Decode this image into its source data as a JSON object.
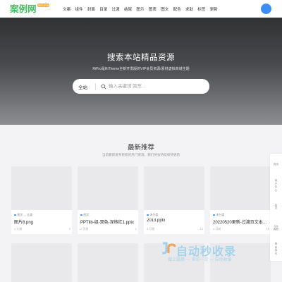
{
  "header": {
    "logo_text": "案例网",
    "logo_badge": "anli.ooo",
    "nav": [
      "文案",
      "组件",
      "封面",
      "目录",
      "过渡",
      "结尾",
      "图示",
      "图表",
      "图文",
      "配色",
      "求助",
      "标签",
      "更新"
    ]
  },
  "hero": {
    "title": "搜索本站精品资源",
    "subtitle": "RiPro是RiTheme全新开发版的VIP会员资源/素材虚拟商城主题",
    "search": {
      "category": "全站",
      "placeholder": "输入关键词 回车..."
    }
  },
  "section": {
    "title": "最新推荐",
    "subtitle": "当前最新发布更新的热门资源，我们将会持续保持更新"
  },
  "cards": [
    {
      "category": "图文",
      "category2": "过渡",
      "title": "图片8.png",
      "author": "4 天前",
      "views": "0",
      "color": "#3a8ef5"
    },
    {
      "category": "图文",
      "title": "PPTlib-组-双色-深核红1.pptx",
      "author": "2 天前",
      "views": "1",
      "color": "#3a8ef5"
    },
    {
      "category": "未分类",
      "title": "2013.pptx",
      "author": "4 月前",
      "views": "12",
      "color": "#3a8ef5"
    },
    {
      "category": "未分类",
      "title": "20220520更新-过渡页文本排版.p...",
      "author": "4 月前",
      "views": "15",
      "color": "#3a8ef5"
    }
  ],
  "float_bar": [
    {
      "label": "首页",
      "icon": "home-icon"
    },
    {
      "label": "用户中心",
      "icon": "user-icon"
    },
    {
      "label": "会员",
      "icon": "vip-icon"
    },
    {
      "label": "QQ客服",
      "icon": "qq-icon"
    },
    {
      "label": "联系我们",
      "icon": "contact-icon"
    }
  ],
  "watermark": {
    "main": "自动秒收录",
    "sub": "做上链接 — 来访一次 — 自动收录"
  },
  "colors": {
    "brand": "#43c062",
    "accent": "#3a8ef5",
    "hero_dark": "#303133"
  }
}
